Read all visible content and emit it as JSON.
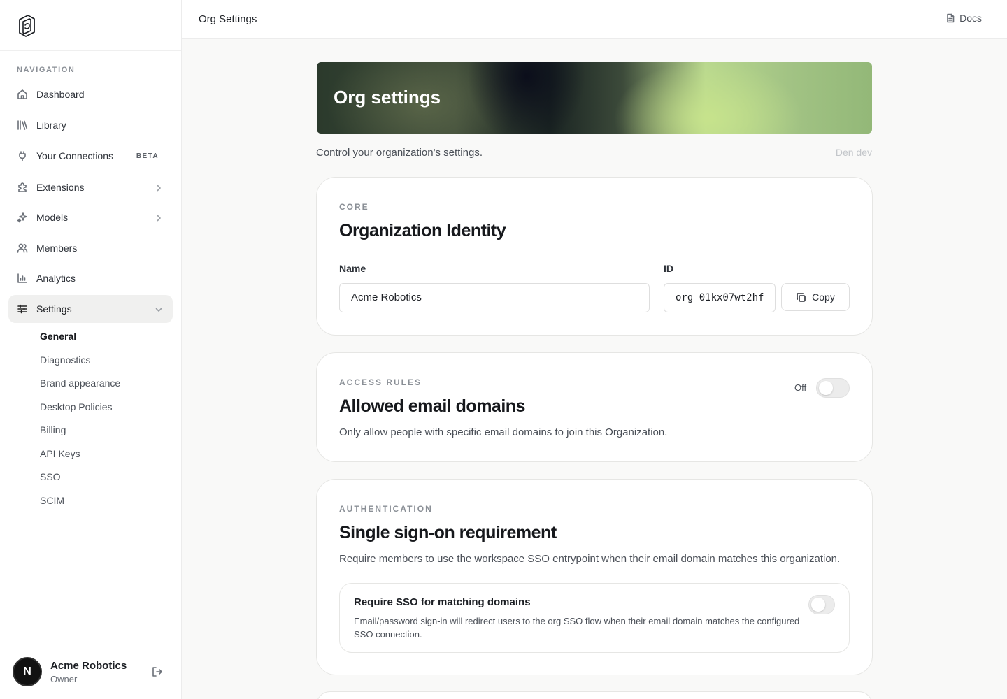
{
  "sidebar": {
    "nav_heading": "NAVIGATION",
    "items": [
      {
        "label": "Dashboard"
      },
      {
        "label": "Library"
      },
      {
        "label": "Your Connections",
        "badge": "BETA"
      },
      {
        "label": "Extensions"
      },
      {
        "label": "Models"
      },
      {
        "label": "Members"
      },
      {
        "label": "Analytics"
      },
      {
        "label": "Settings"
      }
    ],
    "settings_sub": [
      {
        "label": "General"
      },
      {
        "label": "Diagnostics"
      },
      {
        "label": "Brand appearance"
      },
      {
        "label": "Desktop Policies"
      },
      {
        "label": "Billing"
      },
      {
        "label": "API Keys"
      },
      {
        "label": "SSO"
      },
      {
        "label": "SCIM"
      }
    ],
    "user": {
      "initial": "N",
      "name": "Acme Robotics",
      "role": "Owner"
    }
  },
  "topbar": {
    "title": "Org Settings",
    "docs_label": "Docs"
  },
  "main": {
    "banner_title": "Org settings",
    "subtitle": "Control your organization's settings.",
    "env_label": "Den dev",
    "identity": {
      "eyebrow": "CORE",
      "title": "Organization Identity",
      "name_label": "Name",
      "name_value": "Acme Robotics",
      "id_label": "ID",
      "id_value": "org_01kx07wt2hf",
      "copy_label": "Copy"
    },
    "domains": {
      "eyebrow": "ACCESS RULES",
      "title": "Allowed email domains",
      "description": "Only allow people with specific email domains to join this Organization.",
      "toggle_label": "Off",
      "enabled": false
    },
    "sso": {
      "eyebrow": "AUTHENTICATION",
      "title": "Single sign-on requirement",
      "description": "Require members to use the workspace SSO entrypoint when their email domain matches this organization.",
      "option_title": "Require SSO for matching domains",
      "option_description": "Email/password sign-in will redirect users to the org SSO flow when their email domain matches the configured SSO connection.",
      "enabled": false
    }
  },
  "colors": {
    "accent_banner_dark": "#1a2422",
    "accent_banner_light": "#b9d88e",
    "text_primary": "#1c1f24",
    "text_muted": "#8a8f96"
  }
}
